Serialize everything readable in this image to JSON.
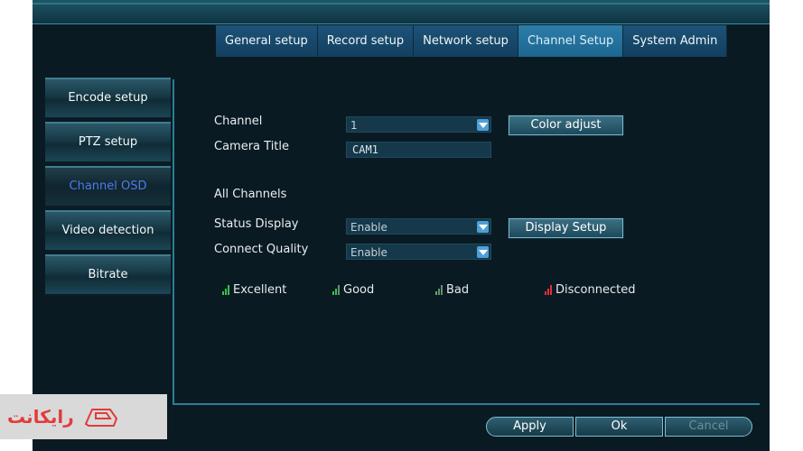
{
  "tabs": [
    {
      "label": "General setup"
    },
    {
      "label": "Record setup"
    },
    {
      "label": "Network setup"
    },
    {
      "label": "Channel Setup"
    },
    {
      "label": "System Admin"
    }
  ],
  "left_menu": [
    {
      "label": "Encode setup"
    },
    {
      "label": "PTZ setup"
    },
    {
      "label": "Channel OSD"
    },
    {
      "label": "Video detection"
    },
    {
      "label": "Bitrate"
    }
  ],
  "form": {
    "channel_label": "Channel",
    "channel_value": "1",
    "camera_title_label": "Camera Title",
    "camera_title_value": "CAM1",
    "all_channels_label": "All Channels",
    "status_display_label": "Status Display",
    "status_display_value": "Enable",
    "connect_quality_label": "Connect Quality",
    "connect_quality_value": "Enable",
    "color_adjust_button": "Color adjust",
    "display_setup_button": "Display Setup"
  },
  "legend": {
    "excellent": "Excellent",
    "good": "Good",
    "bad": "Bad",
    "disconnected": "Disconnected"
  },
  "footer": {
    "apply": "Apply",
    "ok": "Ok",
    "cancel": "Cancel"
  },
  "watermark": {
    "text": "رایکانت"
  },
  "colors": {
    "signal_green": "#36c24a",
    "signal_dim": "#6b8c74",
    "disconnected_red": "#e0303a",
    "active_menu_text": "#4f7be8"
  }
}
